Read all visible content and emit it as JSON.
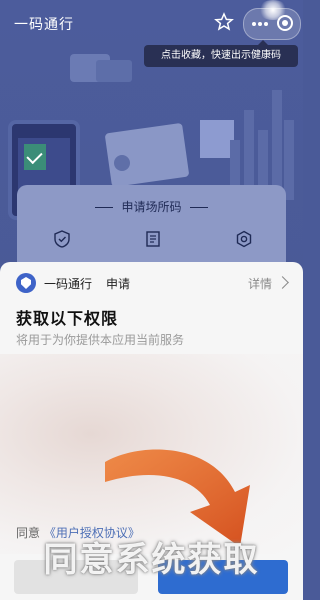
{
  "header": {
    "app_title": "一码通行"
  },
  "tooltip": {
    "text": "点击收藏，快速出示健康码"
  },
  "place_card": {
    "title": "申请场所码"
  },
  "sheet": {
    "miniapp_name": "一码通行",
    "action_label": "申请",
    "detail_link": "详情",
    "permission_title": "获取以下权限",
    "permission_desc": "将用于为你提供本应用当前服务",
    "agree_prefix": "同意",
    "agree_link": "《用户授权协议》"
  },
  "overlay": {
    "caption": "同意系统获取"
  },
  "icons": {
    "star": "star-icon",
    "more": "more-dots-icon",
    "close": "close-icon",
    "shield": "shield-icon",
    "document": "document-icon",
    "settings": "gear-icon",
    "logo": "shield-logo-icon",
    "chevron": "chevron-right-icon",
    "arrow": "curved-arrow-icon"
  },
  "colors": {
    "header_bg": "#4a5a96",
    "brand_blue": "#3e63c8",
    "arrow_orange": "#e56a2c",
    "link_blue": "#4d6fb6"
  }
}
